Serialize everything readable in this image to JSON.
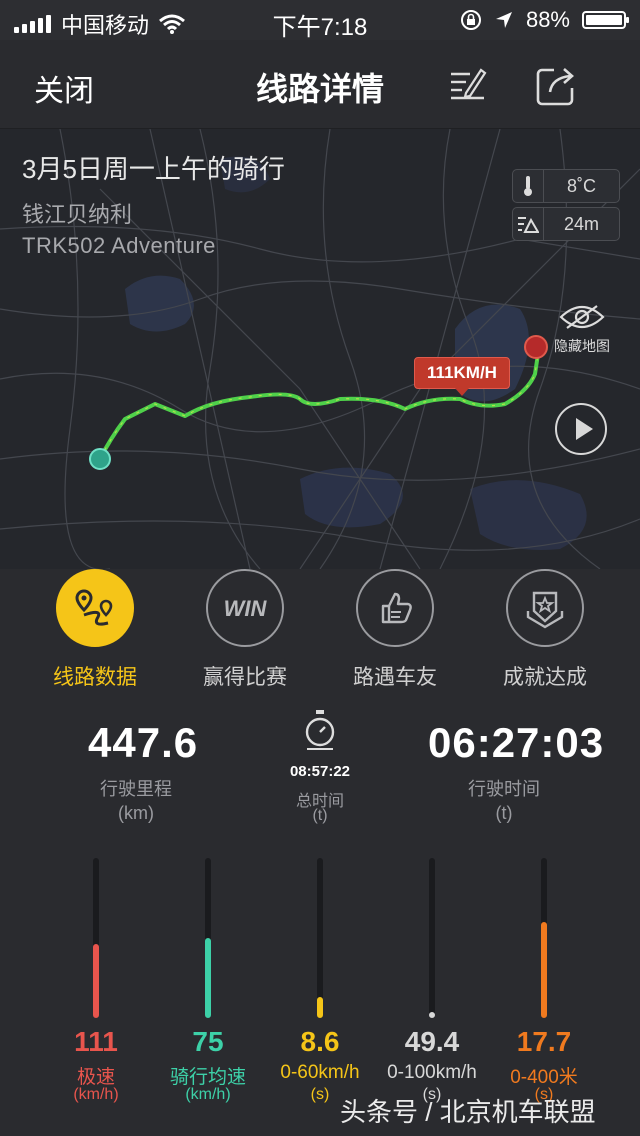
{
  "status_bar": {
    "carrier": "中国移动",
    "time": "下午7:18",
    "battery": "88%",
    "battery_level": 0.88
  },
  "nav": {
    "close": "关闭",
    "title": "线路详情"
  },
  "ride": {
    "title": "3月5日周一上午的骑行",
    "location": "钱江贝纳利",
    "bike": "TRK502 Adventure",
    "temperature": "8˚C",
    "altitude": "24m",
    "max_speed_tag": "111KM/H",
    "hide_map": "隐藏地图"
  },
  "actions": [
    {
      "label": "线路数据",
      "icon": "route-icon",
      "active": true
    },
    {
      "label": "赢得比赛",
      "icon": "win-icon",
      "active": false
    },
    {
      "label": "路遇车友",
      "icon": "thumbs-up-icon",
      "active": false
    },
    {
      "label": "成就达成",
      "icon": "achievement-icon",
      "active": false
    }
  ],
  "stats": {
    "distance": {
      "value": "447.6",
      "label": "行驶里程",
      "unit": "(km)"
    },
    "total_time": {
      "value": "08:57:22",
      "label": "总时间",
      "unit": "(t)"
    },
    "ride_time": {
      "value": "06:27:03",
      "label": "行驶时间",
      "unit": "(t)"
    }
  },
  "bars": [
    {
      "value": "111",
      "label": "极速",
      "unit": "(km/h)",
      "color": "#e8554d",
      "level": 0.46
    },
    {
      "value": "75",
      "label": "骑行均速",
      "unit": "(km/h)",
      "color": "#3dd1a8",
      "level": 0.5
    },
    {
      "value": "8.6",
      "label": "0-60km/h",
      "unit": "(s)",
      "color": "#f5c518",
      "level": 0.13
    },
    {
      "value": "49.4",
      "label": "0-100km/h",
      "unit": "(s)",
      "color": "#d8d8d8",
      "level": 0.03
    },
    {
      "value": "17.7",
      "label": "0-400米",
      "unit": "(s)",
      "color": "#f07a1f",
      "level": 0.6
    }
  ],
  "watermark": "头条号 / 北京机车联盟"
}
